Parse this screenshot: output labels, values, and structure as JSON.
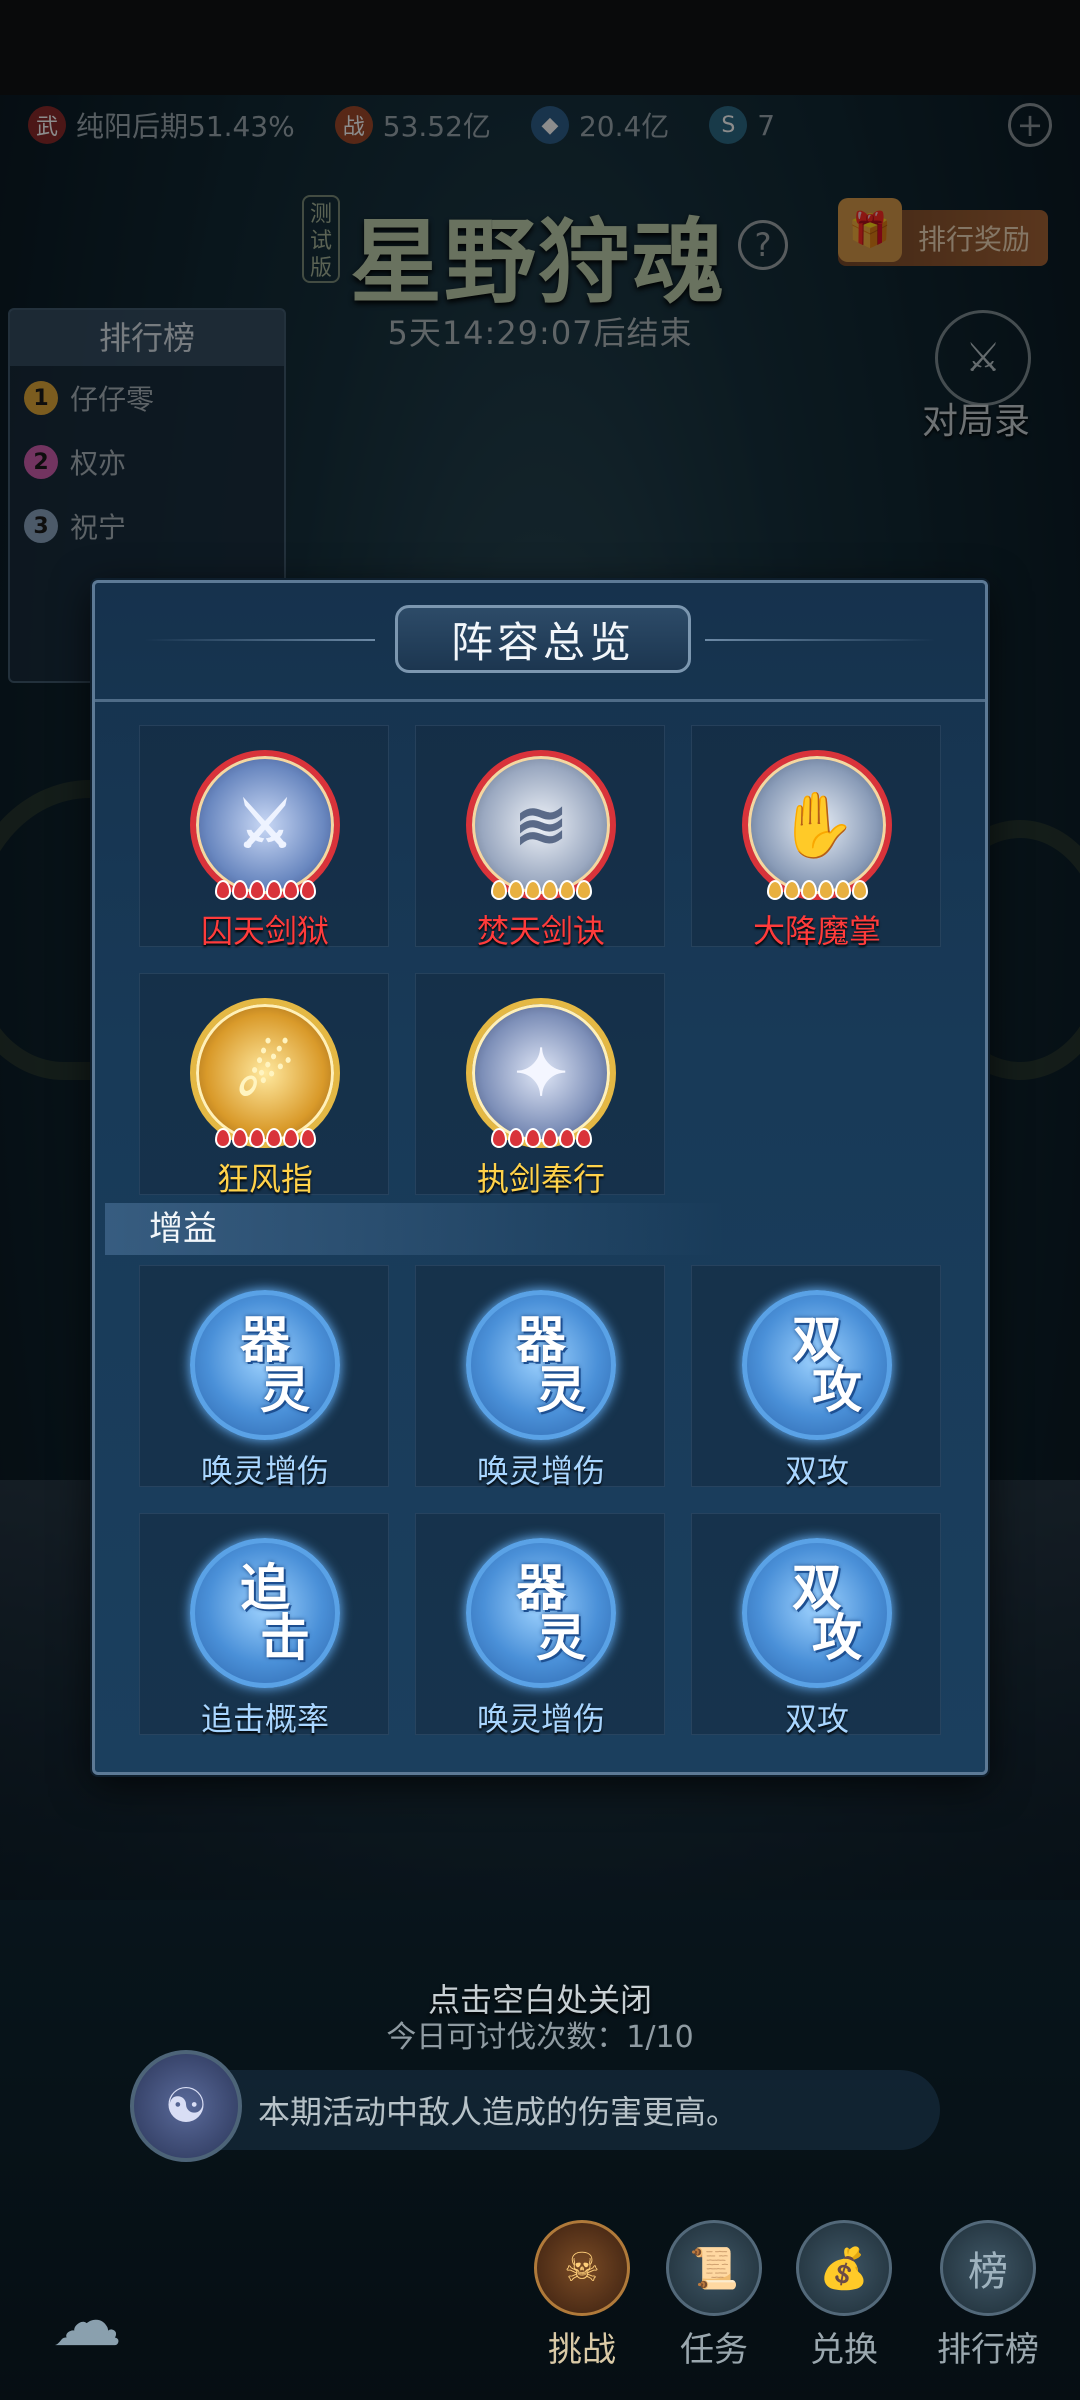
{
  "status_bar": {
    "realm": "纯阳后期51.43%",
    "power": "53.52亿",
    "spirit_stones": "20.4亿",
    "tokens": "7",
    "plus_icon": "plus-icon"
  },
  "event": {
    "test_badge": "测试版",
    "title": "星野狩魂",
    "help_icon": "question-icon",
    "reward_button": "排行奖励",
    "countdown": "5天14:29:07后结束",
    "record_label": "对局录"
  },
  "ranking": {
    "title": "排行榜",
    "items": [
      {
        "rank": "1",
        "name": "仔仔零",
        "color": "#e0a83a"
      },
      {
        "rank": "2",
        "name": "权亦",
        "color": "#d060b0"
      },
      {
        "rank": "3",
        "name": "祝宁",
        "color": "#8aa4c0"
      }
    ]
  },
  "modal": {
    "title": "阵容总览",
    "skills": [
      {
        "name": "囚天剑狱",
        "rarity": "red",
        "art": "⚔"
      },
      {
        "name": "焚天剑诀",
        "rarity": "red",
        "art": "≋"
      },
      {
        "name": "大降魔掌",
        "rarity": "red",
        "art": "✋"
      },
      {
        "name": "狂风指",
        "rarity": "gold",
        "art": "☄"
      },
      {
        "name": "执剑奉行",
        "rarity": "gold",
        "art": "✦"
      }
    ],
    "buff_section_label": "增益",
    "buffs": [
      {
        "name": "唤灵增伤",
        "glyph_top": "器",
        "glyph_bottom": "灵"
      },
      {
        "name": "唤灵增伤",
        "glyph_top": "器",
        "glyph_bottom": "灵"
      },
      {
        "name": "双攻",
        "glyph_top": "双",
        "glyph_bottom": "攻"
      },
      {
        "name": "追击概率",
        "glyph_top": "追",
        "glyph_bottom": "击"
      },
      {
        "name": "唤灵增伤",
        "glyph_top": "器",
        "glyph_bottom": "灵"
      },
      {
        "name": "双攻",
        "glyph_top": "双",
        "glyph_bottom": "攻"
      }
    ]
  },
  "close_hint": "点击空白处关闭",
  "challenge_count": "今日可讨伐次数：1/10",
  "notice": "本期活动中敌人造成的伤害更高。",
  "nav": {
    "challenge": "挑战",
    "tasks": "任务",
    "exchange": "兑换",
    "leaderboard": "排行榜"
  },
  "colors": {
    "red_rarity": "#d9333a",
    "gold_rarity": "#e4b844",
    "buff_blue": "#5aa2e6"
  }
}
